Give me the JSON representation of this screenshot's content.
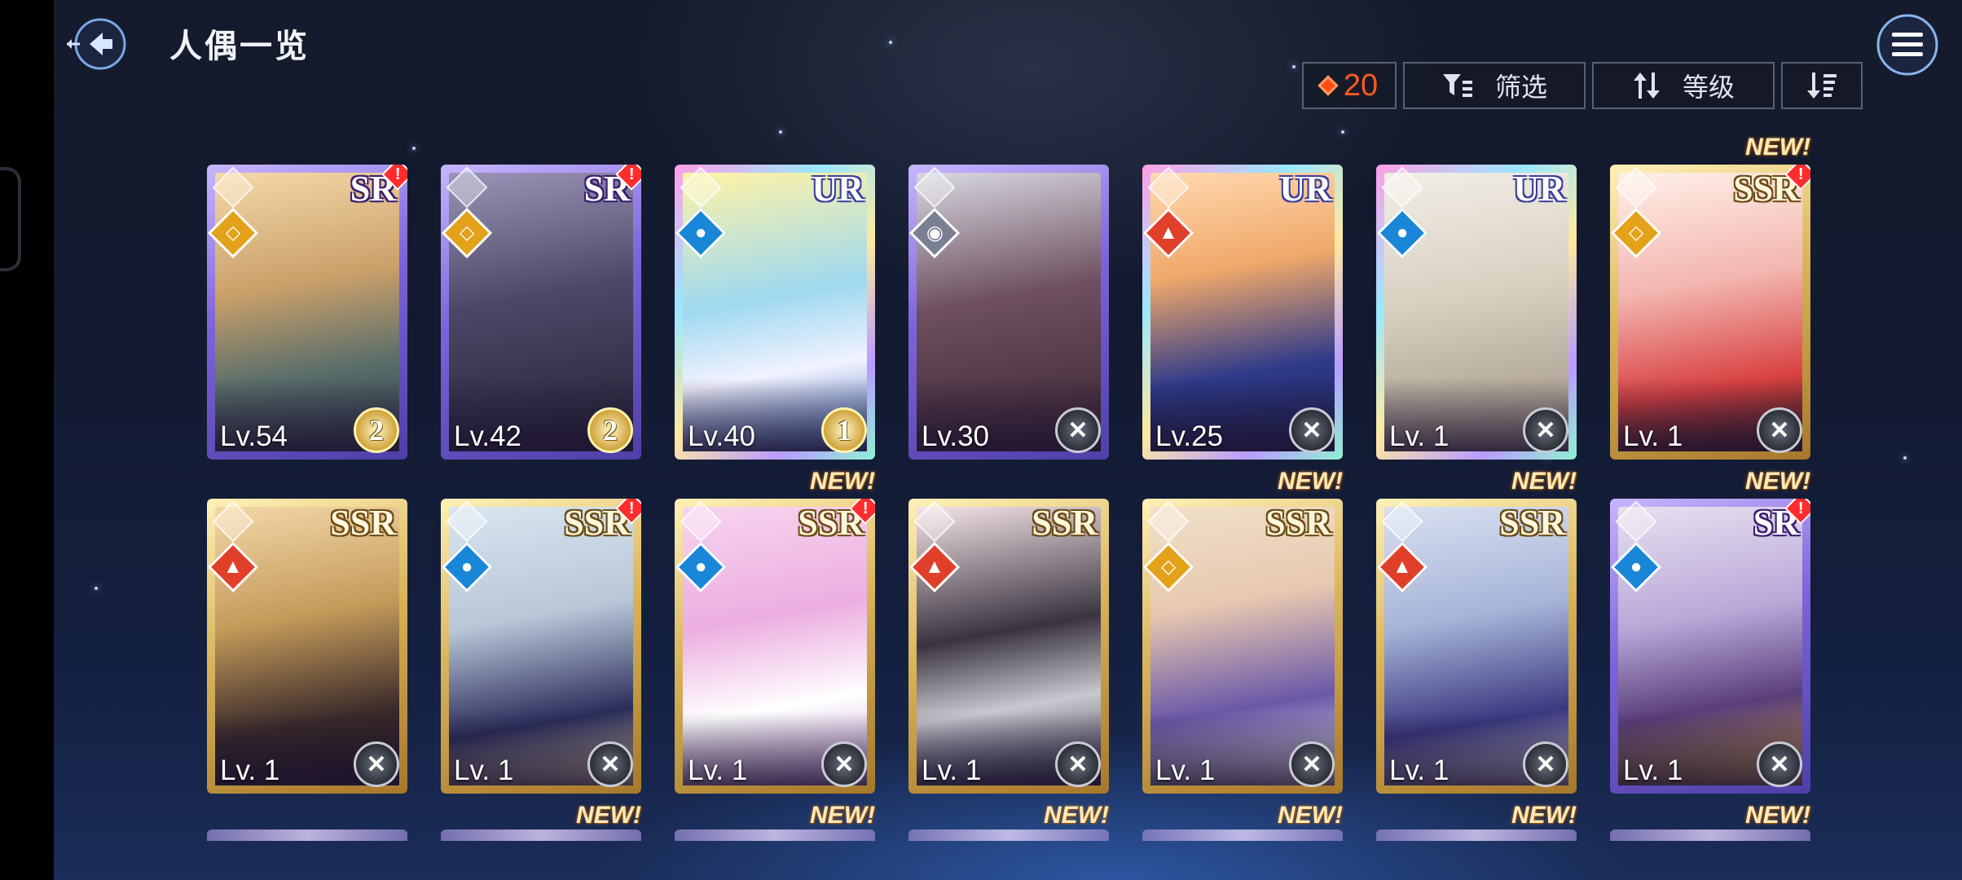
{
  "header": {
    "title": "人偶一览",
    "count": "20",
    "filter_label": "筛选",
    "sort_label": "等级"
  },
  "colors": {
    "count_accent": "#ff5a1f",
    "sr_frame": "#7c63d9",
    "ssr_frame": "#d9b45a",
    "new_tag": "#ffe9b8"
  },
  "icons": {
    "back": "back-arrow-icon",
    "menu": "hamburger-menu-icon",
    "filter": "filter-icon",
    "sort": "sort-arrows-icon",
    "order": "sort-order-icon",
    "currency": "diamond-icon"
  },
  "cards": [
    {
      "rarity": "SR",
      "level": "Lv.54",
      "element": "light",
      "rank": "2",
      "alert": true,
      "is_new": false
    },
    {
      "rarity": "SR",
      "level": "Lv.42",
      "element": "light",
      "rank": "2",
      "alert": true,
      "is_new": false
    },
    {
      "rarity": "UR",
      "level": "Lv.40",
      "element": "water",
      "rank": "1",
      "alert": false,
      "is_new": false
    },
    {
      "rarity": "",
      "level": "Lv.30",
      "element": "dark",
      "rank": "",
      "alert": false,
      "is_new": false
    },
    {
      "rarity": "UR",
      "level": "Lv.25",
      "element": "fire",
      "rank": "",
      "alert": false,
      "is_new": false
    },
    {
      "rarity": "UR",
      "level": "Lv. 1",
      "element": "water",
      "rank": "",
      "alert": false,
      "is_new": false
    },
    {
      "rarity": "SSR",
      "level": "Lv. 1",
      "element": "light",
      "rank": "",
      "alert": true,
      "is_new": true
    },
    {
      "rarity": "SSR",
      "level": "Lv. 1",
      "element": "fire",
      "rank": "",
      "alert": false,
      "is_new": false
    },
    {
      "rarity": "SSR",
      "level": "Lv. 1",
      "element": "water",
      "rank": "",
      "alert": true,
      "is_new": false
    },
    {
      "rarity": "SSR",
      "level": "Lv. 1",
      "element": "water",
      "rank": "",
      "alert": true,
      "is_new": true
    },
    {
      "rarity": "SSR",
      "level": "Lv. 1",
      "element": "fire",
      "rank": "",
      "alert": false,
      "is_new": false
    },
    {
      "rarity": "SSR",
      "level": "Lv. 1",
      "element": "light",
      "rank": "",
      "alert": false,
      "is_new": true
    },
    {
      "rarity": "SSR",
      "level": "Lv. 1",
      "element": "fire",
      "rank": "",
      "alert": false,
      "is_new": true
    },
    {
      "rarity": "SR",
      "level": "Lv. 1",
      "element": "water",
      "rank": "",
      "alert": true,
      "is_new": true
    }
  ],
  "new_label": "NEW!",
  "next_row_new_flags": [
    false,
    true,
    true,
    true,
    true,
    true,
    true
  ]
}
